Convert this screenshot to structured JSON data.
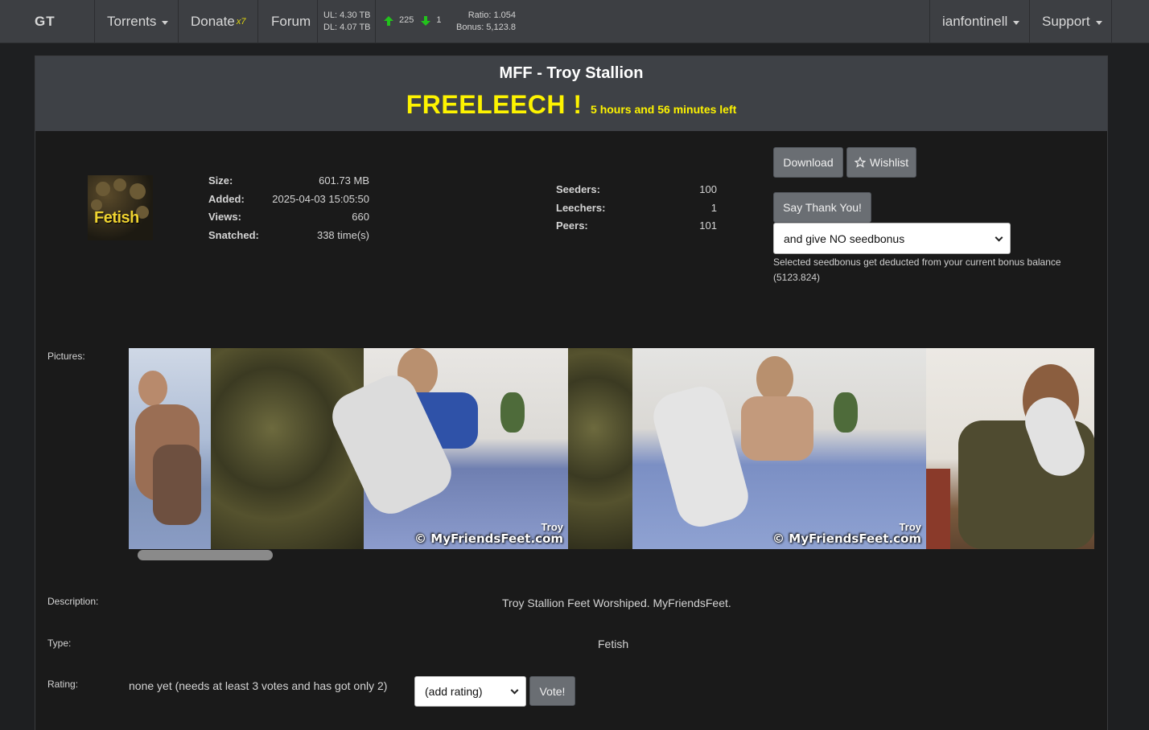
{
  "nav": {
    "logo": "GT",
    "torrents": "Torrents",
    "donate": "Donate",
    "donate_multiplier": "x7",
    "forum": "Forum",
    "ul": "UL: 4.30 TB",
    "dl": "DL: 4.07 TB",
    "seeding_count": "225",
    "leeching_count": "1",
    "ratio": "Ratio: 1.054",
    "bonus": "Bonus: 5,123.8",
    "user": "ianfontinell",
    "support": "Support"
  },
  "torrent": {
    "title": "MFF - Troy Stallion",
    "freeleech": "FREELEECH !",
    "freeleech_time": "5 hours and 56 minutes left",
    "cover_text": "Fetish",
    "size_label": "Size:",
    "size": "601.73 MB",
    "added_label": "Added:",
    "added": "2025-04-03 15:05:50",
    "views_label": "Views:",
    "views": "660",
    "snatched_label": "Snatched:",
    "snatched": "338 time(s)",
    "seeders_label": "Seeders:",
    "seeders": "100",
    "leechers_label": "Leechers:",
    "leechers": "1",
    "peers_label": "Peers:",
    "peers": "101"
  },
  "actions": {
    "download": "Download",
    "wishlist": "Wishlist",
    "thank": "Say Thank You!",
    "seedbonus_selected": "and give NO seedbonus",
    "seedbonus_note": "Selected seedbonus get deducted from your current bonus balance (5123.824)"
  },
  "details": {
    "pictures_label": "Pictures:",
    "watermark_name": "Troy",
    "watermark_site": "© MyFriendsFeet.com",
    "description_label": "Description:",
    "description": "Troy Stallion Feet Worshiped. MyFriendsFeet.",
    "type_label": "Type:",
    "type": "Fetish",
    "rating_label": "Rating:",
    "rating": "none yet (needs at least 3 votes and has got only 2)",
    "rating_select": "(add rating)",
    "vote": "Vote!"
  },
  "colors": {
    "freeleech": "#fdf300",
    "navbar": "#3d3f43",
    "header": "#3e4146",
    "up_arrow": "#22c21c",
    "down_arrow": "#22c21c"
  }
}
